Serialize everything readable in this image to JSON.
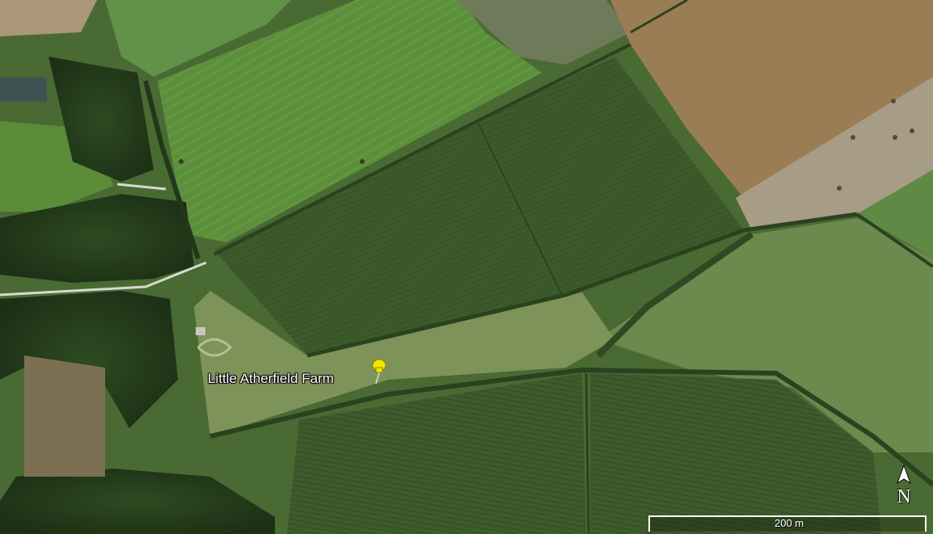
{
  "placemark": {
    "label": "Little Atherfield Farm",
    "icon": "yellow-pushpin-icon",
    "color": "#f2e600"
  },
  "compass": {
    "letter": "N",
    "icon": "north-arrow-icon"
  },
  "scale": {
    "label": "200 m"
  },
  "colors": {
    "dark_crop": "#3e5a2b",
    "light_grass": "#5f8f3f",
    "ploughed": "#9a7d55",
    "stubble": "#a59a82",
    "hedgerow": "#243b1b",
    "track": "#d8d8d0"
  }
}
